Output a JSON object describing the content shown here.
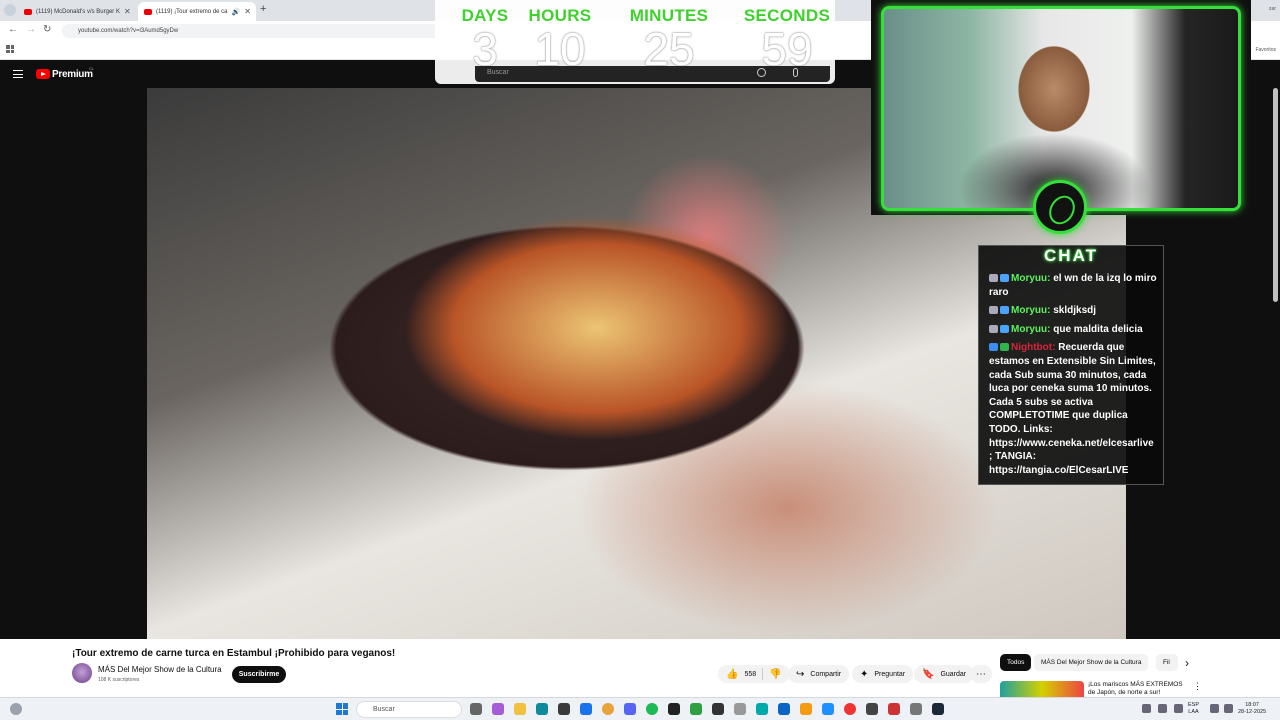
{
  "browser": {
    "tabs": [
      {
        "label": "(1119) McDonald's v/s Burger K"
      },
      {
        "label": "(1119) ¡Tour extremo de ca"
      }
    ],
    "url": "youtube.com/watch?v=l3Aumd5gyDw",
    "right_label": "Favoritos",
    "right_label_top": "zar"
  },
  "youtube": {
    "brand": "Premium",
    "brand_sup": "CL",
    "search_placeholder": "Buscar"
  },
  "countdown": {
    "units": [
      {
        "label": "DAYS",
        "value": "3"
      },
      {
        "label": "HOURS",
        "value": "10"
      },
      {
        "label": "MINUTES",
        "value": "25"
      },
      {
        "label": "SECONDS",
        "value": "59"
      }
    ]
  },
  "chat": {
    "title": "CHAT",
    "messages": [
      {
        "user": "Moryuu:",
        "text": "el wn de la izq lo miro raro"
      },
      {
        "user": "Moryuu:",
        "text": "skldjksdj"
      },
      {
        "user": "Moryuu:",
        "text": "que maldita delicia"
      },
      {
        "user": "Nightbot:",
        "text": "Recuerda que estamos en Extensible Sin Limites, cada Sub suma 30 minutos, cada luca por ceneka suma 10 minutos. Cada 5 subs se activa COMPLETOTIME que duplica TODO. Links: https://www.ceneka.net/elcesarlive ; TANGIA: https://tangia.co/ElCesarLIVE"
      }
    ]
  },
  "video": {
    "title": "¡Tour extremo de carne turca en Estambul ¡Prohibido para veganos!",
    "channel": "MÁS Del Mejor Show de la Cultura",
    "subscribers": "108 K suscriptores",
    "subscribe_label": "Suscribirme",
    "likes": "558",
    "share_label": "Compartir",
    "ask_label": "Preguntar",
    "save_label": "Guardar"
  },
  "sidebar": {
    "chips": [
      "Todos",
      "MÁS Del Mejor Show de la Cultura",
      "Fil"
    ],
    "recommendation_title": "¡Los mariscos MÁS EXTREMOS de Japón, de norte a sur!"
  },
  "taskbar": {
    "search_placeholder": "Buscar",
    "lang_top": "ESP",
    "lang_bottom": "LAA",
    "time": "18:07",
    "date": "28-12-2025"
  },
  "colors": {
    "accent_green": "#36e03a",
    "youtube_red": "#ff0000"
  }
}
